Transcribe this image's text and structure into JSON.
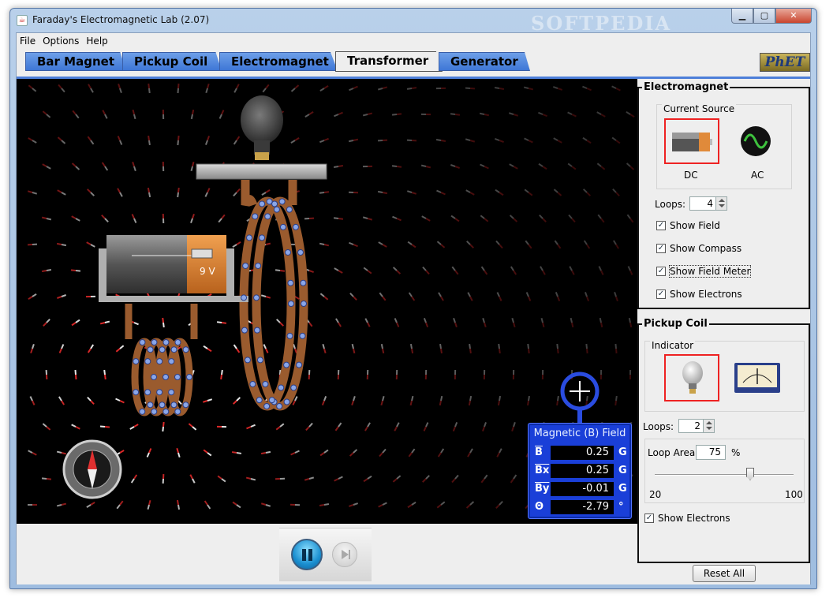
{
  "window": {
    "title": "Faraday's Electromagnetic Lab (2.07)",
    "watermark": "SOFTPEDIA",
    "minimize": "▁",
    "maximize": "▢",
    "close": "✕"
  },
  "menu": [
    "File",
    "Options",
    "Help"
  ],
  "tabs": [
    {
      "label": "Bar Magnet",
      "active": false
    },
    {
      "label": "Pickup Coil",
      "active": false
    },
    {
      "label": "Electromagnet",
      "active": false
    },
    {
      "label": "Transformer",
      "active": true
    },
    {
      "label": "Generator",
      "active": false
    }
  ],
  "logo": "PhET",
  "canvas": {
    "battery_label": "9 V"
  },
  "field_meter": {
    "title": "Magnetic (B) Field",
    "rows": [
      {
        "label": "B",
        "value": "0.25",
        "unit": "G"
      },
      {
        "label": "Bx",
        "value": "0.25",
        "unit": "G"
      },
      {
        "label": "By",
        "value": "-0.01",
        "unit": "G"
      },
      {
        "label": "Θ",
        "value": "-2.79",
        "unit": "°"
      }
    ]
  },
  "electromagnet_panel": {
    "title": "Electromagnet",
    "current_source": {
      "title": "Current Source",
      "dc_label": "DC",
      "ac_label": "AC",
      "selected": "DC"
    },
    "loops_label": "Loops:",
    "loops_value": "4",
    "checkboxes": [
      {
        "label": "Show Field",
        "checked": true
      },
      {
        "label": "Show Compass",
        "checked": true
      },
      {
        "label": "Show Field Meter",
        "checked": true
      },
      {
        "label": "Show Electrons",
        "checked": true
      }
    ]
  },
  "pickup_panel": {
    "title": "Pickup Coil",
    "indicator": {
      "title": "Indicator",
      "selected": "lightbulb",
      "voltmeter_caption": "voltage"
    },
    "loops_label": "Loops:",
    "loops_value": "2",
    "loop_area": {
      "label": "Loop Area:",
      "value": "75",
      "unit": "%",
      "min_label": "20",
      "max_label": "100",
      "slider_fraction": 0.6875
    },
    "show_electrons": {
      "label": "Show Electrons",
      "checked": true
    }
  },
  "reset_label": "Reset All",
  "colors": {
    "tab": "#4d84e0",
    "meter": "#1a3fd8",
    "selection": "#e22222",
    "coil": "#9a5b2e"
  }
}
